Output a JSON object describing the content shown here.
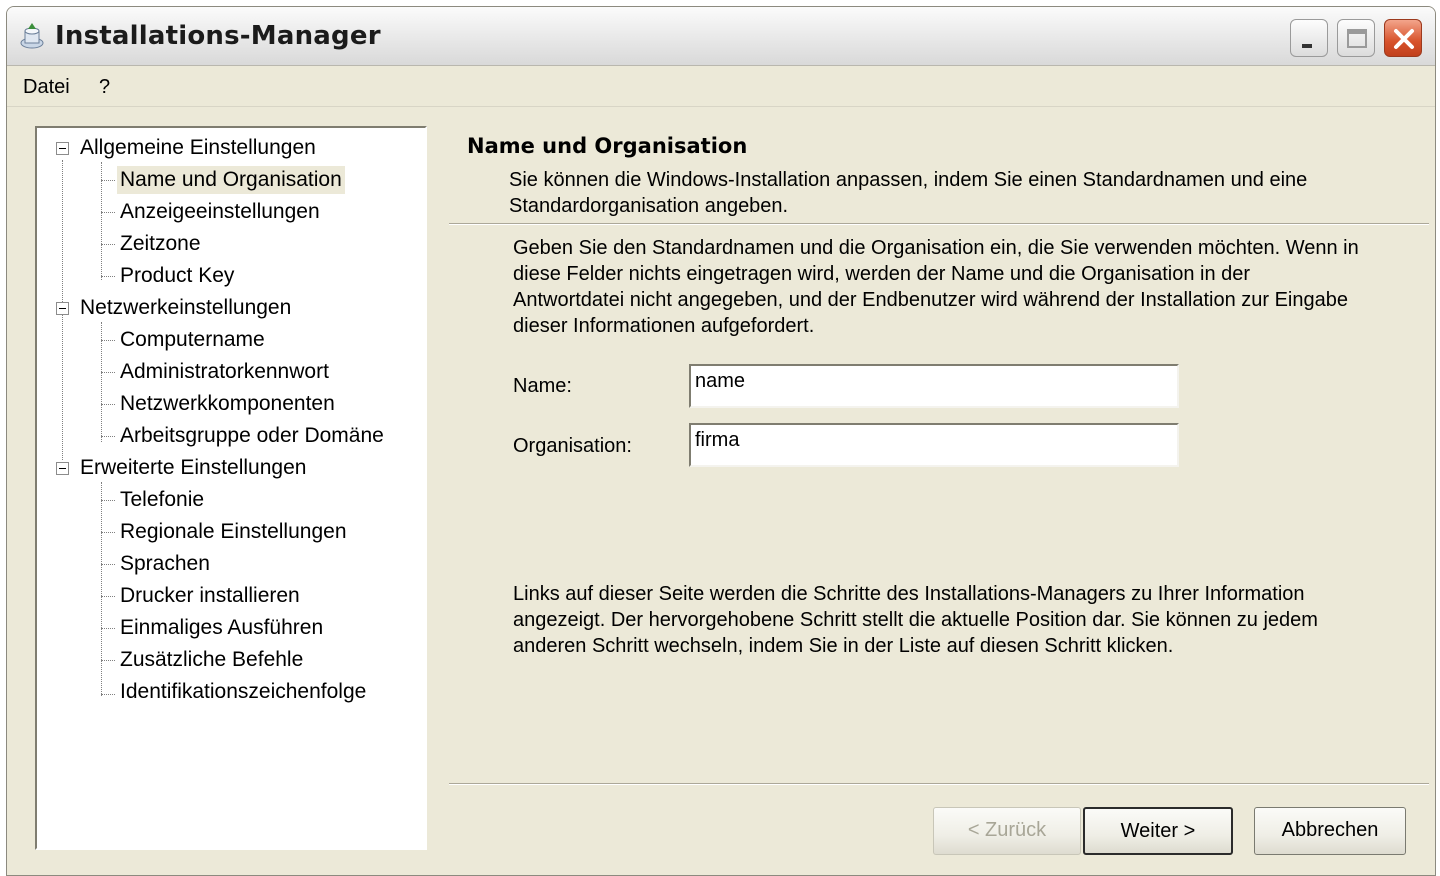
{
  "window": {
    "title": "Installations-Manager"
  },
  "menu": {
    "items": [
      "Datei",
      "?"
    ]
  },
  "tree": {
    "groups": [
      {
        "label": "Allgemeine Einstellungen",
        "children": [
          "Name und Organisation",
          "Anzeigeeinstellungen",
          "Zeitzone",
          "Product Key"
        ]
      },
      {
        "label": "Netzwerkeinstellungen",
        "children": [
          "Computername",
          "Administratorkennwort",
          "Netzwerkkomponenten",
          "Arbeitsgruppe oder Domäne"
        ]
      },
      {
        "label": "Erweiterte Einstellungen",
        "children": [
          "Telefonie",
          "Regionale Einstellungen",
          "Sprachen",
          "Drucker installieren",
          "Einmaliges Ausführen",
          "Zusätzliche Befehle",
          "Identifikationszeichenfolge"
        ]
      }
    ],
    "selected": "Name und Organisation"
  },
  "content": {
    "title": "Name und Organisation",
    "subtitle": "Sie können die Windows-Installation anpassen, indem Sie einen Standardnamen und eine Standardorganisation angeben.",
    "instructions": "Geben Sie den Standardnamen und die Organisation ein, die Sie verwenden möchten. Wenn in diese Felder nichts eingetragen wird, werden der Name und die Organisation in der Antwortdatei nicht angegeben, und der Endbenutzer wird während der Installation zur Eingabe dieser Informationen aufgefordert.",
    "name_label": "Name:",
    "name_value": "name",
    "org_label": "Organisation:",
    "org_value": "firma",
    "info": "Links auf dieser Seite werden die Schritte des Installations-Managers zu Ihrer Information angezeigt. Der hervorgehobene Schritt stellt die aktuelle Position dar. Sie können zu jedem anderen Schritt wechseln, indem Sie in der Liste auf diesen Schritt klicken."
  },
  "buttons": {
    "back": "< Zurück",
    "next": "Weiter >",
    "cancel": "Abbrechen"
  }
}
